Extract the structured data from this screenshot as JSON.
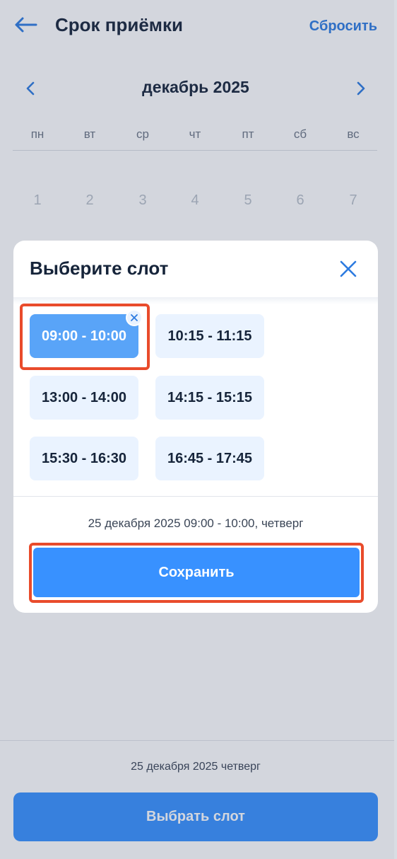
{
  "header": {
    "title": "Срок приёмки",
    "reset_label": "Сбросить"
  },
  "calendar": {
    "month_label": "декабрь 2025",
    "weekdays": [
      "пн",
      "вт",
      "ср",
      "чт",
      "пт",
      "сб",
      "вс"
    ],
    "days": [
      "1",
      "2",
      "3",
      "4",
      "5",
      "6",
      "7"
    ]
  },
  "bottom": {
    "date_text": "25 декабря 2025 четверг",
    "select_button_label": "Выбрать слот"
  },
  "modal": {
    "title": "Выберите слот",
    "slots": [
      {
        "label": "09:00 - 10:00",
        "selected": true
      },
      {
        "label": "10:15 - 11:15",
        "selected": false
      },
      {
        "label": "13:00 - 14:00",
        "selected": false
      },
      {
        "label": "14:15 - 15:15",
        "selected": false
      },
      {
        "label": "15:30 - 16:30",
        "selected": false
      },
      {
        "label": "16:45 - 17:45",
        "selected": false
      }
    ],
    "summary": "25 декабря 2025 09:00 - 10:00, четверг",
    "save_label": "Сохранить"
  },
  "colors": {
    "accent": "#3891ff",
    "selected_slot": "#59a4f8",
    "slot_background": "#eaf3ff",
    "highlight": "#e94b2b"
  }
}
